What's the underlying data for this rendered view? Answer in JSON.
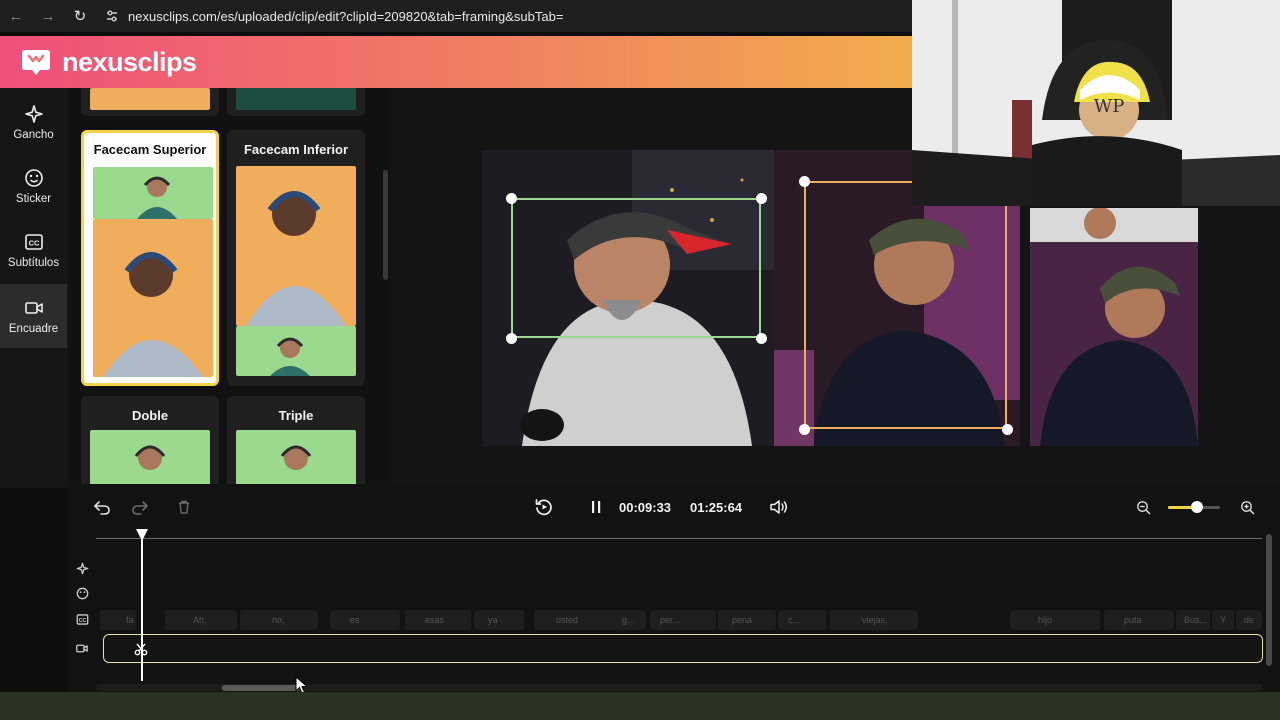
{
  "browser": {
    "url": "nexusclips.com/es/uploaded/clip/edit?clipId=209820&tab=framing&subTab="
  },
  "app": {
    "brand": "nexusclips",
    "header_gradient": [
      "#ef4f7a",
      "#f5c73c"
    ],
    "accent": "#f3d34a"
  },
  "sidebar": {
    "items": [
      {
        "label": "Gancho",
        "icon": "sparkle-icon",
        "active": false
      },
      {
        "label": "Sticker",
        "icon": "sticker-icon",
        "active": false
      },
      {
        "label": "Subtítulos",
        "icon": "cc-icon",
        "active": false
      },
      {
        "label": "Encuadre",
        "icon": "video-camera-icon",
        "active": true
      }
    ]
  },
  "templates": [
    {
      "label": "Facecam Superior",
      "selected": true
    },
    {
      "label": "Facecam Inferior",
      "selected": false
    },
    {
      "label": "Doble",
      "selected": false
    },
    {
      "label": "Triple",
      "selected": false
    }
  ],
  "player": {
    "current_time": "00:09:33",
    "duration": "01:25:64",
    "state": "playing"
  },
  "timeline": {
    "subtitle_words": [
      "fa",
      "Ah,",
      "no,",
      "es",
      "esas",
      "ya",
      "usted",
      "g...",
      "per...",
      "pena",
      "c...",
      "viejas,",
      "hijo",
      "puta",
      "Bus...",
      "Y",
      "de"
    ],
    "zoom_level": 0.6
  }
}
